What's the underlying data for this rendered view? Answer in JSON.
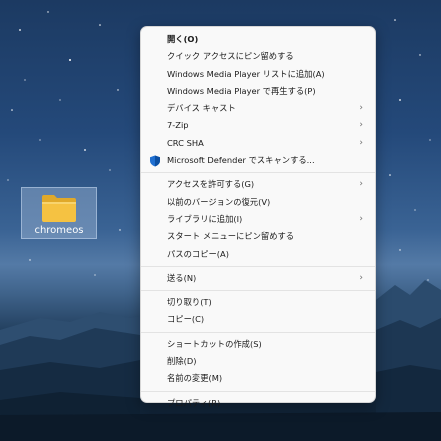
{
  "desktop": {
    "folder": {
      "label": "chromeos",
      "icon": "folder-icon"
    }
  },
  "context_menu": {
    "groups": [
      [
        {
          "label": "開く(O)",
          "bold": true,
          "submenu": false
        },
        {
          "label": "クイック アクセスにピン留めする",
          "submenu": false
        },
        {
          "label": "Windows Media Player リストに追加(A)",
          "submenu": false
        },
        {
          "label": "Windows Media Player で再生する(P)",
          "submenu": false
        },
        {
          "label": "デバイス キャスト",
          "submenu": true
        },
        {
          "label": "7-Zip",
          "submenu": true
        },
        {
          "label": "CRC SHA",
          "submenu": true
        },
        {
          "label": "Microsoft Defender でスキャンする...",
          "submenu": false,
          "icon": "defender-shield-icon"
        }
      ],
      [
        {
          "label": "アクセスを許可する(G)",
          "submenu": true
        },
        {
          "label": "以前のバージョンの復元(V)",
          "submenu": false
        },
        {
          "label": "ライブラリに追加(I)",
          "submenu": true
        },
        {
          "label": "スタート メニューにピン留めする",
          "submenu": false
        },
        {
          "label": "パスのコピー(A)",
          "submenu": false
        }
      ],
      [
        {
          "label": "送る(N)",
          "submenu": true
        }
      ],
      [
        {
          "label": "切り取り(T)",
          "submenu": false
        },
        {
          "label": "コピー(C)",
          "submenu": false
        }
      ],
      [
        {
          "label": "ショートカットの作成(S)",
          "submenu": false
        },
        {
          "label": "削除(D)",
          "submenu": false
        },
        {
          "label": "名前の変更(M)",
          "submenu": false
        }
      ],
      [
        {
          "label": "プロパティ(R)",
          "submenu": false
        }
      ]
    ]
  },
  "colors": {
    "menu_bg": "#f9f9f9",
    "menu_text": "#1a1a1a",
    "separator": "#e3e3e3",
    "folder_yellow": "#f5c242",
    "defender_blue": "#1f6fd1"
  }
}
